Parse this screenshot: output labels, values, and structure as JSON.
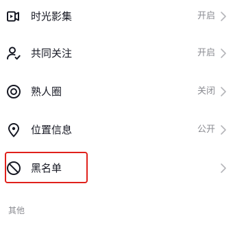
{
  "settings": {
    "items": [
      {
        "icon": "play-film-icon",
        "label": "时光影集",
        "value": "开启"
      },
      {
        "icon": "person-check-icon",
        "label": "共同关注",
        "value": "开启"
      },
      {
        "icon": "target-circle-icon",
        "label": "熟人圈",
        "value": "关闭"
      },
      {
        "icon": "location-pin-icon",
        "label": "位置信息",
        "value": "公开"
      },
      {
        "icon": "block-prohibited-icon",
        "label": "黑名单",
        "value": ""
      }
    ]
  },
  "other_section": {
    "title": "其他"
  },
  "colors": {
    "highlight": "#e0201a",
    "text_primary": "#161823",
    "text_secondary": "#8a8b91"
  }
}
